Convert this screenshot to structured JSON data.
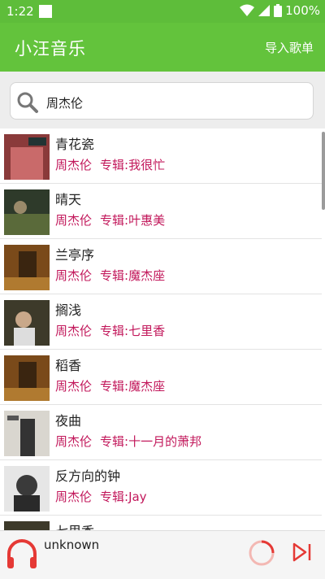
{
  "statusbar": {
    "time": "1:22",
    "battery": "100%"
  },
  "appbar": {
    "title": "小汪音乐",
    "action": "导入歌单"
  },
  "search": {
    "value": "周杰伦"
  },
  "songs": [
    {
      "title": "青花瓷",
      "artist": "周杰伦",
      "album": "专辑:我很忙"
    },
    {
      "title": "晴天",
      "artist": "周杰伦",
      "album": "专辑:叶惠美"
    },
    {
      "title": "兰亭序",
      "artist": "周杰伦",
      "album": "专辑:魔杰座"
    },
    {
      "title": "搁浅",
      "artist": "周杰伦",
      "album": "专辑:七里香"
    },
    {
      "title": "稻香",
      "artist": "周杰伦",
      "album": "专辑:魔杰座"
    },
    {
      "title": "夜曲",
      "artist": "周杰伦",
      "album": "专辑:十一月的萧邦"
    },
    {
      "title": "反方向的钟",
      "artist": "周杰伦",
      "album": "专辑:Jay"
    },
    {
      "title": "七里香",
      "artist": "",
      "album": ""
    }
  ],
  "player": {
    "track": "unknown"
  },
  "colors": {
    "green": "#63c33c",
    "artist_text": "#c2185b",
    "player_icon": "#e53935"
  }
}
